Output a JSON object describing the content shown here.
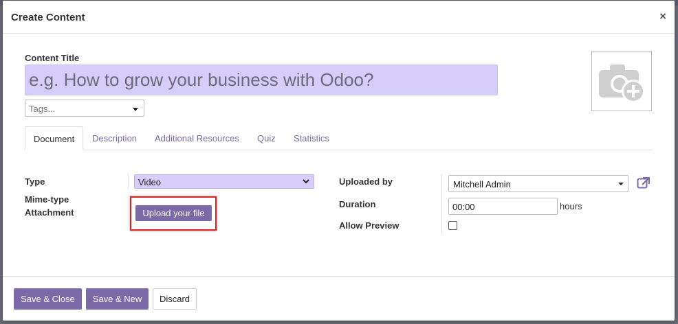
{
  "dialog": {
    "title": "Create Content",
    "close_glyph": "×"
  },
  "form": {
    "content_title_label": "Content Title",
    "content_title_placeholder": "e.g. How to grow your business with Odoo?",
    "tags_placeholder": "Tags...",
    "image_icon": "camera-plus-icon"
  },
  "tabs": [
    {
      "label": "Document",
      "active": true
    },
    {
      "label": "Description",
      "active": false
    },
    {
      "label": "Additional Resources",
      "active": false
    },
    {
      "label": "Quiz",
      "active": false
    },
    {
      "label": "Statistics",
      "active": false
    }
  ],
  "document": {
    "type_label": "Type",
    "type_value": "Video",
    "mime_label": "Mime-type",
    "attachment_label": "Attachment",
    "upload_label": "Upload your file",
    "uploaded_by_label": "Uploaded by",
    "uploaded_by_value": "Mitchell Admin",
    "external_link_icon": "external-link-icon",
    "duration_label": "Duration",
    "duration_value": "00:00",
    "duration_unit": "hours",
    "allow_preview_label": "Allow Preview",
    "allow_preview_checked": false
  },
  "footer": {
    "save_close": "Save & Close",
    "save_new": "Save & New",
    "discard": "Discard"
  },
  "colors": {
    "accent": "#7c6aa8",
    "input_highlight": "#d7cdfb",
    "annotation_red": "#e02020"
  }
}
